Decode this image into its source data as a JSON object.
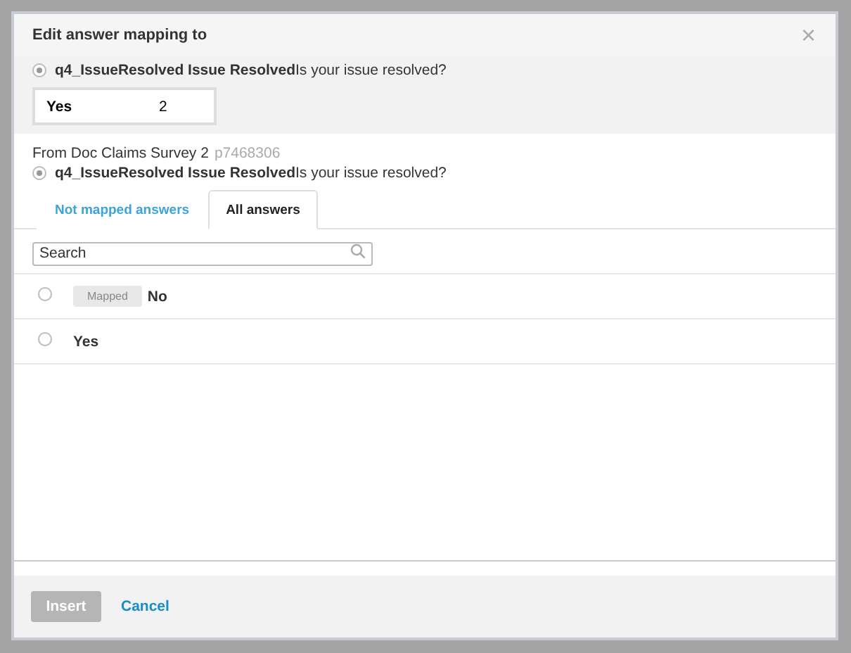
{
  "dialog": {
    "title": "Edit answer mapping to",
    "close": "×"
  },
  "target": {
    "question": "q4_IssueResolved Issue Resolved",
    "text": "Is your issue resolved?",
    "selected": true,
    "answer": "Yes",
    "code": "2"
  },
  "source": {
    "label": "From Doc Claims Survey 2",
    "id": "p7468306",
    "question": "q4_IssueResolved Issue Resolved",
    "text": "Is your issue resolved?",
    "selected": true
  },
  "tabs": [
    {
      "label": "Not mapped answers",
      "selected": false
    },
    {
      "label": "All answers",
      "selected": true
    }
  ],
  "search": {
    "placeholder": "Search"
  },
  "answers": [
    {
      "label": "No",
      "badge": "Mapped",
      "selected": false
    },
    {
      "label": "Yes",
      "selected": false
    }
  ],
  "buttons": [
    {
      "label": "Insert",
      "disabled": true,
      "kind": "primary"
    },
    {
      "label": "Cancel",
      "disabled": false,
      "kind": "link"
    }
  ]
}
